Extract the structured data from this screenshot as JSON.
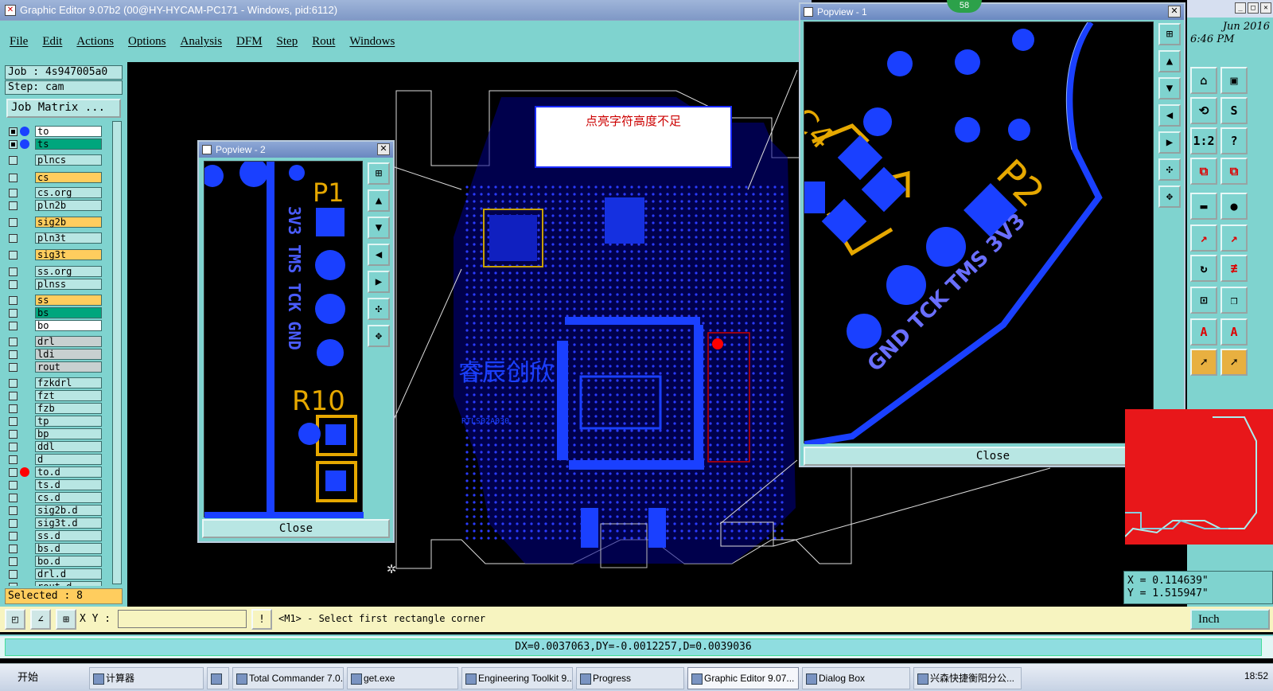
{
  "window": {
    "title": "Graphic Editor 9.07b2 (00@HY-HYCAM-PC171 - Windows, pid:6112)"
  },
  "menu": [
    "File",
    "Edit",
    "Actions",
    "Options",
    "Analysis",
    "DFM",
    "Step",
    "Rout",
    "Windows"
  ],
  "job": {
    "job_label": "Job : 4s947005a0",
    "step_label": "Step: cam",
    "matrix_button": "Job Matrix ..."
  },
  "layers": [
    {
      "name": "to",
      "bg": "#ffffff"
    },
    {
      "name": "ts",
      "bg": "#00a67d"
    },
    {
      "name": "plncs",
      "bg": "#b8e6e3"
    },
    {
      "name": "cs",
      "bg": "#ffcd5e"
    },
    {
      "name": "cs.org",
      "bg": "#b8e6e3"
    },
    {
      "name": "pln2b",
      "bg": "#b8e6e3"
    },
    {
      "name": "sig2b",
      "bg": "#ffcd5e"
    },
    {
      "name": "pln3t",
      "bg": "#b8e6e3"
    },
    {
      "name": "sig3t",
      "bg": "#ffcd5e"
    },
    {
      "name": "ss.org",
      "bg": "#b8e6e3"
    },
    {
      "name": "plnss",
      "bg": "#b8e6e3"
    },
    {
      "name": "ss",
      "bg": "#ffcd5e"
    },
    {
      "name": "bs",
      "bg": "#00a67d"
    },
    {
      "name": "bo",
      "bg": "#ffffff"
    },
    {
      "name": "drl",
      "bg": "#c8d0d0"
    },
    {
      "name": "ldi",
      "bg": "#c8d0d0"
    },
    {
      "name": "rout",
      "bg": "#c8d0d0"
    },
    {
      "name": "fzkdrl",
      "bg": "#b8e6e3"
    },
    {
      "name": "fzt",
      "bg": "#b8e6e3"
    },
    {
      "name": "fzb",
      "bg": "#b8e6e3"
    },
    {
      "name": "tp",
      "bg": "#b8e6e3"
    },
    {
      "name": "bp",
      "bg": "#b8e6e3"
    },
    {
      "name": "ddl",
      "bg": "#b8e6e3"
    },
    {
      "name": "d",
      "bg": "#b8e6e3"
    },
    {
      "name": "to.d",
      "bg": "#b8e6e3"
    },
    {
      "name": "ts.d",
      "bg": "#b8e6e3"
    },
    {
      "name": "cs.d",
      "bg": "#b8e6e3"
    },
    {
      "name": "sig2b.d",
      "bg": "#b8e6e3"
    },
    {
      "name": "sig3t.d",
      "bg": "#b8e6e3"
    },
    {
      "name": "ss.d",
      "bg": "#b8e6e3"
    },
    {
      "name": "bs.d",
      "bg": "#b8e6e3"
    },
    {
      "name": "bo.d",
      "bg": "#b8e6e3"
    },
    {
      "name": "drl.d",
      "bg": "#b8e6e3"
    },
    {
      "name": "rout.d",
      "bg": "#b8e6e3"
    }
  ],
  "selected": "Selected : 8",
  "note_text": "点亮字符高度不足",
  "popup2": {
    "title": "Popview - 2",
    "close": "Close",
    "labels": {
      "p1": "P1",
      "pins": "3V3 TMS TCK GND",
      "r10": "R10"
    }
  },
  "popup1": {
    "title": "Popview - 1",
    "close": "Close",
    "labels": {
      "p2": "P2",
      "pins": "GND TCK TMS 3V3",
      "c4": "C4"
    },
    "badge": "58"
  },
  "board_labels": {
    "logo": "睿辰创欣",
    "part": "RTLS02A030"
  },
  "datetime": {
    "date": "Jun 2016",
    "time": "6:46 PM"
  },
  "coords": {
    "x": "X = 0.114639\"",
    "y": "Y = 1.515947\""
  },
  "command": {
    "xy_label": "X Y :",
    "xy_value": "",
    "prompt": "<M1> - Select first rectangle corner",
    "units": "Inch"
  },
  "measure": "DX=0.0037063,DY=-0.0012257,D=0.0039036",
  "taskbar": {
    "start": "开始",
    "items": [
      "计算器",
      "",
      "Total Commander 7.0...",
      "get.exe",
      "Engineering Toolkit 9....",
      "Progress",
      "Graphic Editor 9.07...",
      "Dialog Box",
      "兴森快捷衡阳分公..."
    ],
    "clock": "18:52"
  }
}
